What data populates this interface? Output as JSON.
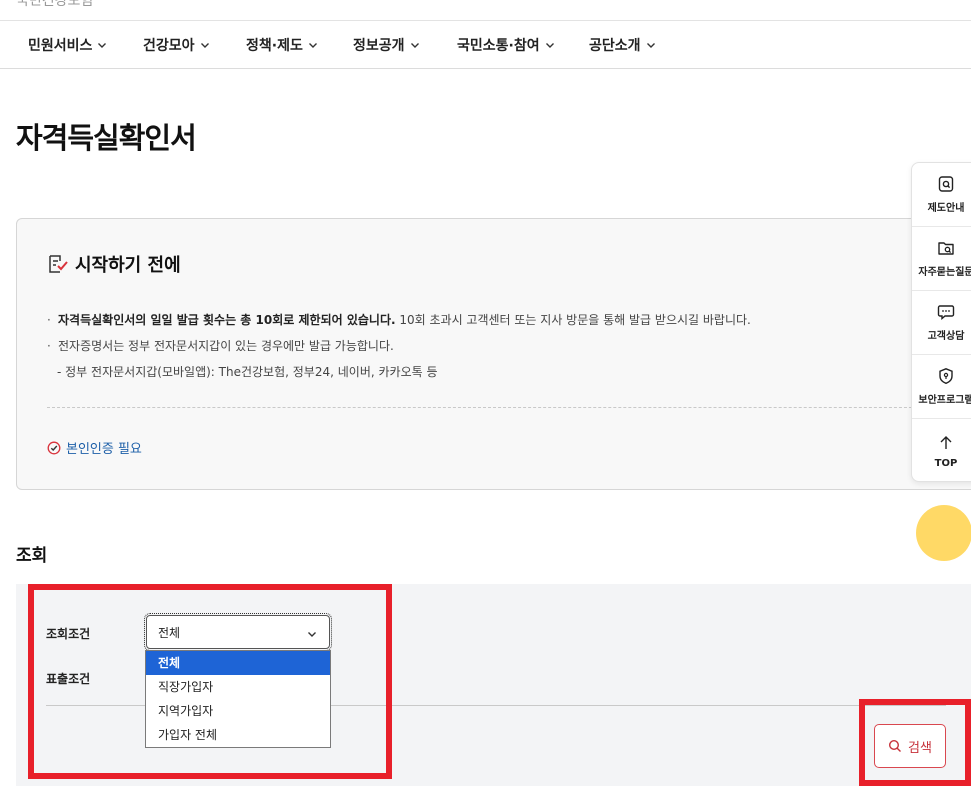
{
  "site": {
    "name": "국민건강보험"
  },
  "gnb": {
    "items": [
      {
        "label": "민원서비스"
      },
      {
        "label": "건강모아"
      },
      {
        "label": "정책·제도"
      },
      {
        "label": "정보공개"
      },
      {
        "label": "국민소통·참여"
      },
      {
        "label": "공단소개"
      }
    ]
  },
  "page": {
    "title": "자격득실확인서"
  },
  "notice": {
    "title": "시작하기 전에",
    "line1_bold": "자격득실확인서의 일일 발급 횟수는 총 10회로 제한되어 있습니다.",
    "line1_rest": " 10회 초과시 고객센터 또는 지사 방문을 통해 발급 받으시길 바랍니다.",
    "line2": "전자증명서는 정부 전자문서지갑이 있는 경우에만 발급 가능합니다.",
    "line3": "- 정부 전자문서지갑(모바일앱): The건강보험, 정부24, 네이버, 카카오톡 등",
    "auth_link": "본인인증 필요"
  },
  "quick_menu": {
    "items": [
      {
        "label": "제도안내",
        "icon": "document-search-icon"
      },
      {
        "label": "자주묻는질문",
        "icon": "folder-search-icon"
      },
      {
        "label": "고객상담",
        "icon": "chat-icon"
      },
      {
        "label": "보안프로그램",
        "icon": "shield-icon"
      },
      {
        "label": "TOP",
        "icon": "arrow-up-icon"
      }
    ]
  },
  "search": {
    "section_title": "조회",
    "condition_label": "조회조건",
    "output_label": "표출조건",
    "selected_value": "전체",
    "options": [
      "전체",
      "직장가입자",
      "지역가입자",
      "가입자 전체"
    ],
    "button_label": "검색"
  },
  "colors": {
    "highlight": "#e8202a",
    "accent_red": "#d9474f",
    "link_blue": "#1d5fa8",
    "dropdown_selected": "#1e64d6",
    "chat_bubble": "#ffd966"
  }
}
